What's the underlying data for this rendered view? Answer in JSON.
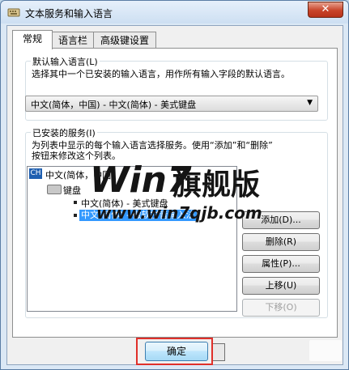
{
  "window": {
    "title": "文本服务和输入语言",
    "close_glyph": "✕"
  },
  "tabs": [
    {
      "label": "常规",
      "active": true
    },
    {
      "label": "语言栏",
      "active": false
    },
    {
      "label": "高级键设置",
      "active": false
    }
  ],
  "default_language": {
    "group_label": "默认输入语言(L)",
    "description": "选择其中一个已安装的输入语言，用作所有输入字段的默认语言。",
    "selected_value": "中文(简体，中国) - 中文(简体) - 美式键盘"
  },
  "installed_services": {
    "group_label": "已安装的服务(I)",
    "description_line1": "为列表中显示的每个输入语言选择服务。使用“添加”和“删除”",
    "description_line2": "按钮来修改这个列表。",
    "tree": {
      "language_badge": "CH",
      "language": "中文(简体，中国)",
      "category": "键盘",
      "items": [
        "中文(简体) - 美式键盘",
        "中文(简体) - 微软拼音输入法"
      ]
    }
  },
  "buttons": {
    "add": "添加(D)...",
    "remove": "删除(R)",
    "properties": "属性(P)...",
    "move_up": "上移(U)",
    "move_down": "下移(O)",
    "ok": "确定"
  },
  "watermark": {
    "brand_a": "Win7",
    "brand_b": "旗舰版",
    "url": "www.win7qjb.com"
  },
  "colors": {
    "selection": "#3399ff",
    "highlight_frame": "#e0302a",
    "close_button": "#c8442a"
  }
}
